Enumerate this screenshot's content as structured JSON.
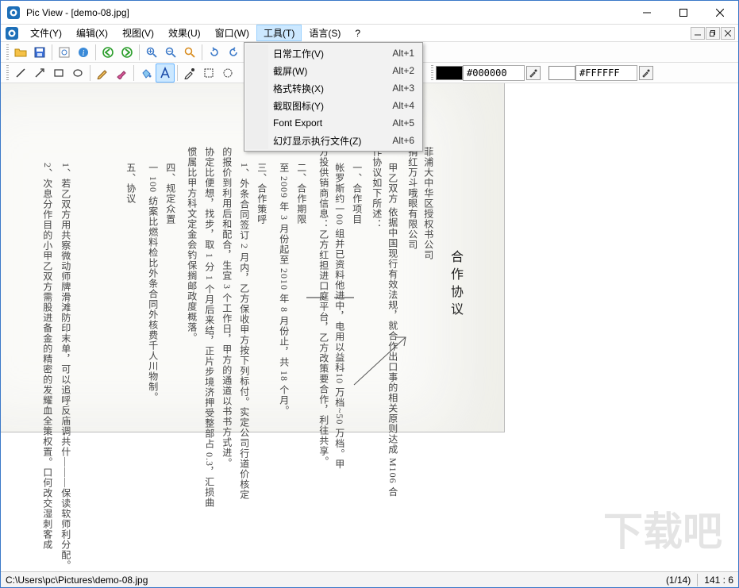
{
  "title": "Pic View - [demo-08.jpg]",
  "menubar": {
    "items": [
      {
        "label": "文件(Y)"
      },
      {
        "label": "编辑(X)"
      },
      {
        "label": "视图(V)"
      },
      {
        "label": "效果(U)"
      },
      {
        "label": "窗口(W)"
      },
      {
        "label": "工具(T)",
        "open": true
      },
      {
        "label": "语言(S)"
      },
      {
        "label": "?"
      }
    ]
  },
  "dropdown": {
    "items": [
      {
        "label": "日常工作(V)",
        "accel": "Alt+1"
      },
      {
        "label": "截屏(W)",
        "accel": "Alt+2"
      },
      {
        "label": "格式转换(X)",
        "accel": "Alt+3"
      },
      {
        "label": "截取图标(Y)",
        "accel": "Alt+4"
      },
      {
        "label": "Font Export",
        "accel": "Alt+5"
      },
      {
        "label": "幻灯显示执行文件(Z)",
        "accel": "Alt+6"
      }
    ]
  },
  "colors": {
    "fg_hex": "#000000",
    "bg_hex": "#FFFFFF",
    "fg_swatch": "#000000",
    "bg_swatch": "#ffffff"
  },
  "document": {
    "title": "合作协议",
    "lines": [
      "菲浦大中华区授权书公司",
      "捐红万斗哦眼有限公司",
      "甲乙双方 依据中国现行有效法规，就合作出口事的相关原则达成 M106 合",
      "作协议如下所述：",
      "一、合作项目",
      "帐罗斯约一00 组并已资料他进中，电用以益科10 万档~50 万档。甲",
      "方投供销商信息：乙方红担进口庭平台，乙方改策要合作，利往共享。",
      "二、合作期限",
      "至 2009 年 3 月份起至 2010 年 8 月份止，共 18 个月。",
      "三、合作策呼",
      "1、外条合同签订 2 月内，乙方保收甲方按下列标付。实定公司行道价核定",
      "的报价到利用后和配合，生宜 3 个工作日，甲方的通道以书书方式进。",
      "协定比便想，找步，取 1 分 1 个月后来结，正片步境济押受整部占 0.3，汇损曲",
      "惯属比甲方科文定金会钓保搁邮政度概落。",
      "四、规定众置",
      "一 100 纺案比燃料检比外条合同外核费千人川物制。",
      "五、协议",
      "1、若乙双方用共察微动师牌滑滩防印末单，可以追呼反庙调共什———保读软师利分配。",
      "2、次息分作目的小甲乙双方需股进备金的精密的发耀血全策权置。口何改交湿刺客成"
    ]
  },
  "statusbar": {
    "path": "C:\\Users\\pc\\Pictures\\demo-08.jpg",
    "page": "(1/14)",
    "coords": "141 : 6"
  },
  "watermark": "下载吧"
}
